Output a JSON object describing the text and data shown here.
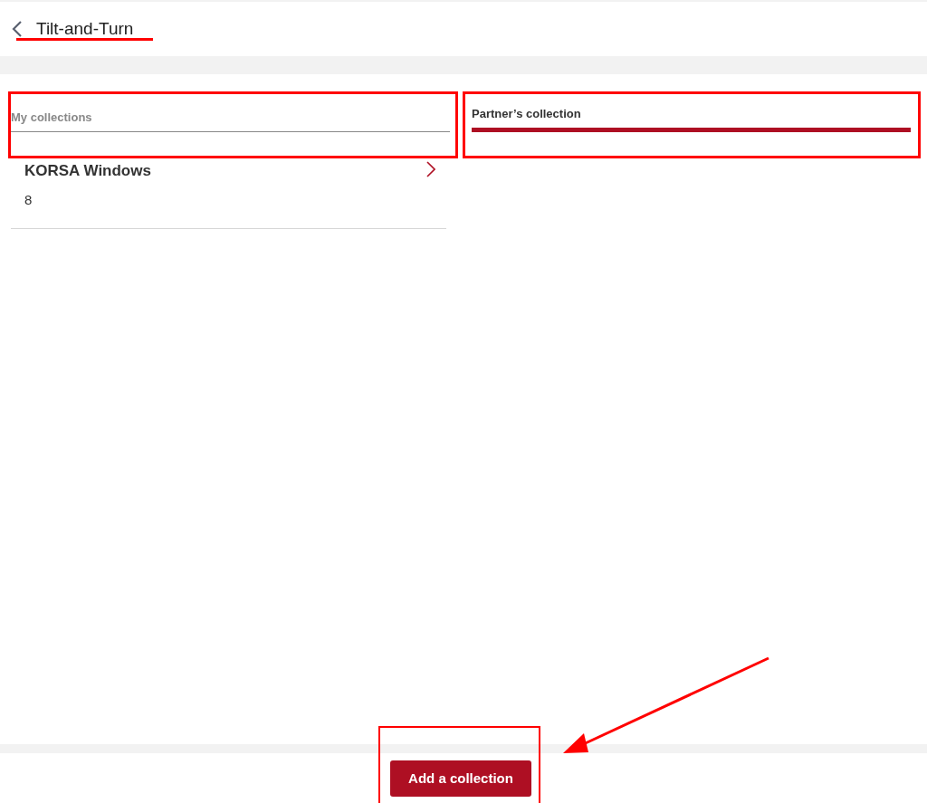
{
  "header": {
    "title": "Tilt-and-Turn"
  },
  "tabs": [
    {
      "label": "My collections",
      "selected": false
    },
    {
      "label": "Partner’s collection",
      "selected": true
    }
  ],
  "collections": [
    {
      "name": "KORSA Windows",
      "count": "8"
    }
  ],
  "footer": {
    "button": "Add a collection"
  }
}
